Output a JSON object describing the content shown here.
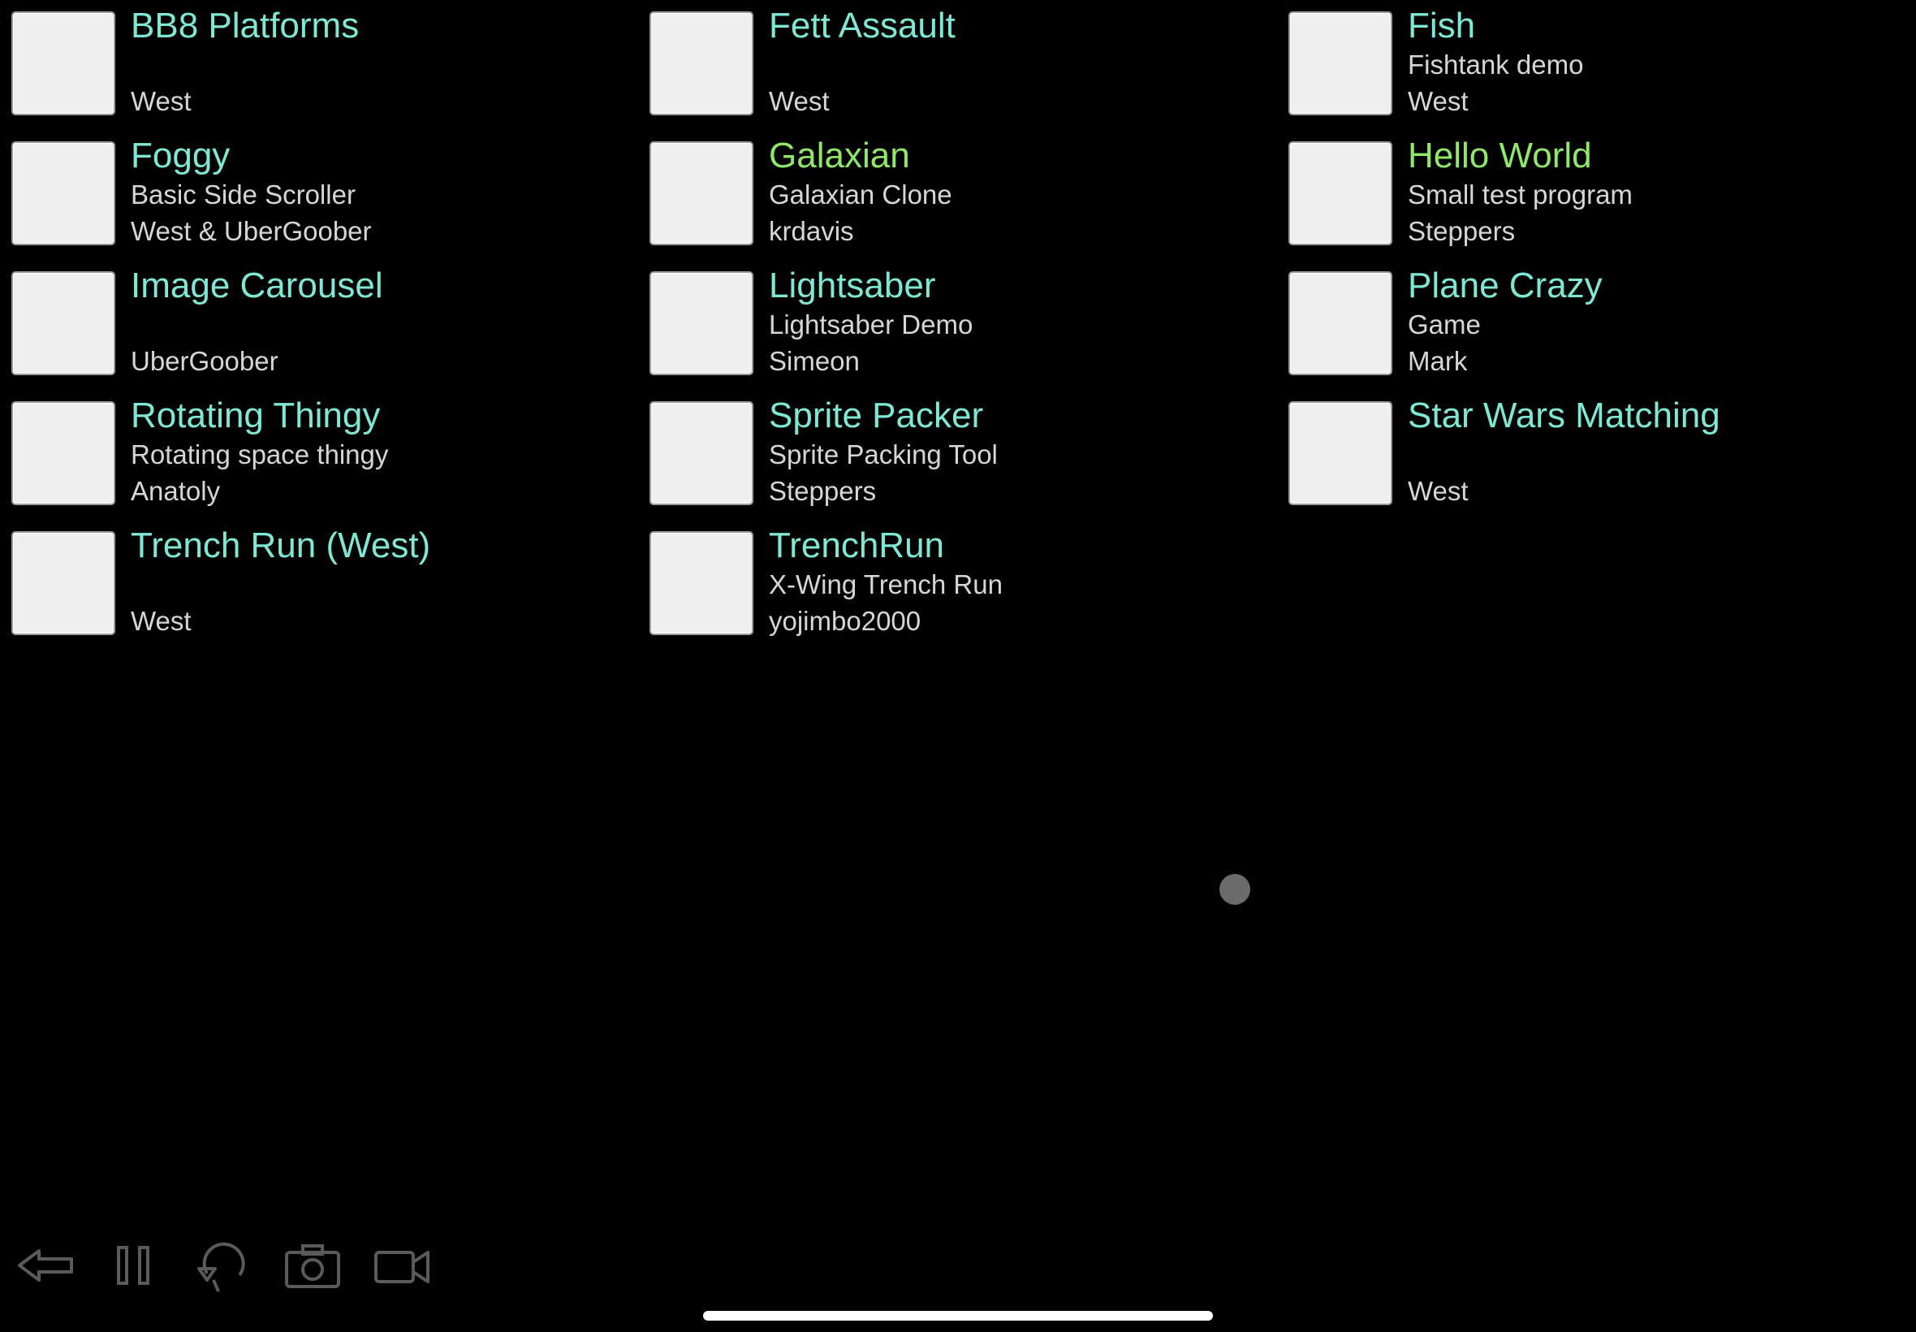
{
  "projects": [
    {
      "title": "BB8 Platforms",
      "line1": "",
      "line2": "West",
      "example": false
    },
    {
      "title": "Fett Assault",
      "line1": "",
      "line2": "West",
      "example": false
    },
    {
      "title": "Fish",
      "line1": "Fishtank demo",
      "line2": "West",
      "example": false
    },
    {
      "title": "Foggy",
      "line1": "Basic Side Scroller",
      "line2": "West & UberGoober",
      "example": false
    },
    {
      "title": "Galaxian",
      "line1": "Galaxian Clone",
      "line2": "krdavis",
      "example": true
    },
    {
      "title": "Hello World",
      "line1": "Small test program",
      "line2": "Steppers",
      "example": true
    },
    {
      "title": "Image Carousel",
      "line1": "",
      "line2": "UberGoober",
      "example": false
    },
    {
      "title": "Lightsaber",
      "line1": "Lightsaber Demo",
      "line2": "Simeon",
      "example": false
    },
    {
      "title": "Plane Crazy",
      "line1": "Game",
      "line2": "Mark",
      "example": false
    },
    {
      "title": "Rotating Thingy",
      "line1": "Rotating space thingy",
      "line2": "Anatoly",
      "example": false
    },
    {
      "title": "Sprite Packer",
      "line1": "Sprite Packing Tool",
      "line2": "Steppers",
      "example": false
    },
    {
      "title": "Star Wars Matching",
      "line1": "",
      "line2": "West",
      "example": false
    },
    {
      "title": "Trench Run (West)",
      "line1": "",
      "line2": "West",
      "example": false
    },
    {
      "title": "TrenchRun",
      "line1": "X-Wing Trench Run",
      "line2": "yojimbo2000",
      "example": false
    }
  ],
  "colors": {
    "background": "#000000",
    "title": "#7fe8d4",
    "example_title": "#8fe86a",
    "subtitle": "#d6d6d6",
    "thumbnail": "#f0f0f0",
    "toolbar_icon": "#5a5a5a"
  },
  "toolbar": {
    "icons": [
      "back-arrow-icon",
      "pause-icon",
      "restart-icon",
      "camera-icon",
      "video-camera-icon"
    ]
  }
}
